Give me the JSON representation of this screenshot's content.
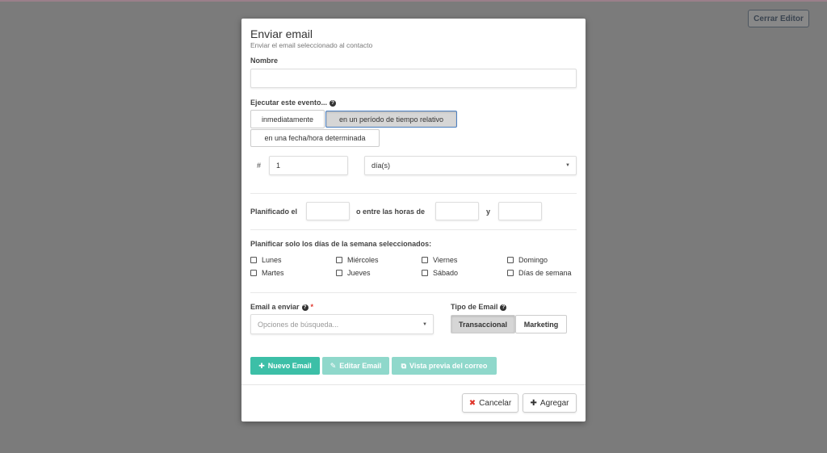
{
  "header": {
    "close_editor_label": "Cerrar Editor"
  },
  "modal": {
    "title": "Enviar email",
    "subtitle": "Enviar el email seleccionado al contacto",
    "name_label": "Nombre",
    "name_value": "",
    "trigger_label": "Ejecutar este evento...",
    "trigger_options": [
      "inmediatamente",
      "en un período de tiempo relativo",
      "en una fecha/hora determinada"
    ],
    "trigger_selected": "en un período de tiempo relativo",
    "hash_label": "#",
    "interval_value": "1",
    "unit_value": "día(s)",
    "scheduled_label": "Planificado el",
    "between_label": "o entre las horas de",
    "and_label": "y",
    "weekdays_label": "Planificar solo los días de la semana seleccionados:",
    "weekdays": [
      "Lunes",
      "Miércoles",
      "Viernes",
      "Domingo",
      "Martes",
      "Jueves",
      "Sábado",
      "Días de semana"
    ],
    "email_label": "Email a enviar",
    "email_placeholder": "Opciones de búsqueda...",
    "email_type_label": "Tipo de Email",
    "email_types": [
      "Transaccional",
      "Marketing"
    ],
    "email_type_selected": "Transaccional",
    "new_email_label": "Nuevo Email",
    "edit_email_label": "Editar Email",
    "preview_label": "Vista previa del correo",
    "cancel_label": "Cancelar",
    "add_label": "Agregar"
  },
  "colors": {
    "overlay": "#7b7b7b",
    "teal": "#3cbfa7",
    "teal_light": "#8fd8cb",
    "cancel_icon": "#e0352b"
  },
  "icons": [
    "question-circle-icon",
    "plus-icon",
    "edit-icon",
    "external-link-icon",
    "times-icon",
    "chevron-down-icon"
  ]
}
